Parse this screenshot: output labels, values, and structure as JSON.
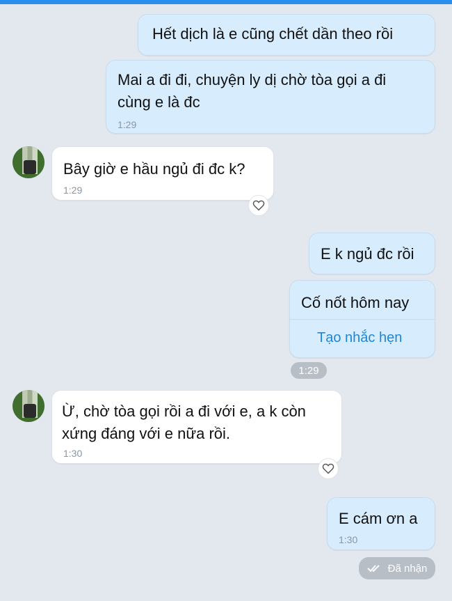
{
  "messages": [
    {
      "side": "out",
      "text": "Hết dịch là e cũng chết dần theo rồi"
    },
    {
      "side": "out",
      "text": "Mai a đi đi, chuyện ly dị chờ tòa gọi a đi\ncùng e là đc",
      "time": "1:29"
    },
    {
      "side": "in",
      "text": "Bây giờ e hầu ngủ đi đc k?",
      "time": "1:29"
    },
    {
      "side": "out",
      "text": "E k ngủ đc rồi"
    },
    {
      "side": "out",
      "text": "Cố nốt hôm nay",
      "action": "Tạo nhắc hẹn"
    },
    {
      "side": "in",
      "text": "Ừ, chờ tòa gọi rồi a đi với e, a k còn\nxứng đáng với e nữa rồi.",
      "time": "1:30"
    },
    {
      "side": "out",
      "text": "E cám ơn a",
      "time": "1:30"
    }
  ],
  "time_pill": "1:29",
  "status": {
    "text": "Đã nhận",
    "icon": "double-check-icon"
  },
  "colors": {
    "outgoing_bubble": "#d7ecfd",
    "incoming_bubble": "#ffffff",
    "background": "#e3e8ee",
    "accent": "#1f86d6"
  }
}
